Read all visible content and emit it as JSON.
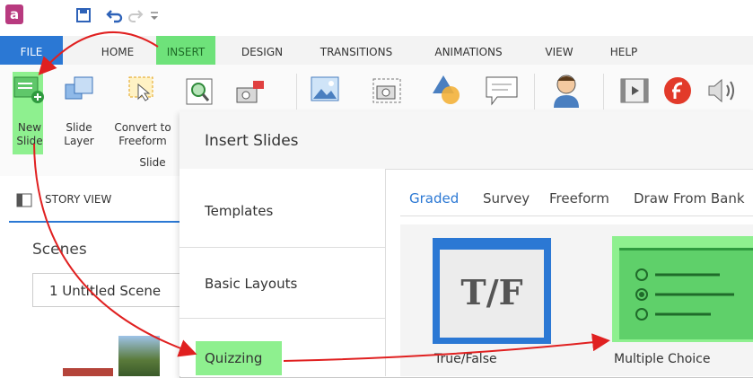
{
  "titlebar": {
    "app_icon_letter": "a"
  },
  "tabs": [
    {
      "label": "FILE"
    },
    {
      "label": "HOME"
    },
    {
      "label": "INSERT"
    },
    {
      "label": "DESIGN"
    },
    {
      "label": "TRANSITIONS"
    },
    {
      "label": "ANIMATIONS"
    },
    {
      "label": "VIEW"
    },
    {
      "label": "HELP"
    }
  ],
  "ribbon": {
    "new_slide": [
      "New",
      "Slide"
    ],
    "slide_layer": [
      "Slide",
      "Layer"
    ],
    "convert": [
      "Convert to",
      "Freeform"
    ],
    "group_label": "Slide"
  },
  "storyview": {
    "tab_label": "STORY VIEW",
    "scenes_label": "Scenes",
    "scene_select": "1 Untitled Scene"
  },
  "dialog": {
    "title": "Insert Slides",
    "categories": [
      "Templates",
      "Basic Layouts",
      "Quizzing"
    ],
    "subtabs": [
      "Graded",
      "Survey",
      "Freeform",
      "Draw From Bank"
    ],
    "cards": [
      {
        "label": "True/False",
        "glyph": "T/F"
      },
      {
        "label": "Multiple Choice"
      }
    ]
  },
  "colors": {
    "accent": "#2b78d4",
    "highlight": "#6ee27a",
    "arrow": "#e02020"
  }
}
